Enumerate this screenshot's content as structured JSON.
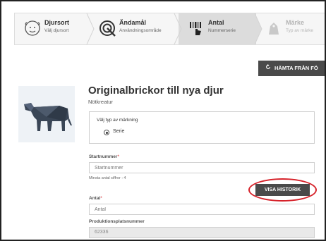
{
  "stepper": {
    "steps": [
      {
        "title": "Djursort",
        "subtitle": "Välj djursort"
      },
      {
        "title": "Ändamål",
        "subtitle": "Användningsområde"
      },
      {
        "title": "Antal",
        "subtitle": "Nummerserie"
      },
      {
        "title": "Märke",
        "subtitle": "Typ av märke"
      }
    ],
    "active_index": 2
  },
  "toolbar": {
    "import_label": "HÄMTA FRÅN FÖ"
  },
  "header": {
    "title": "Originalbrickor till nya djur",
    "subtitle": "Nötkreatur"
  },
  "marking": {
    "label": "Välj typ av märkning",
    "option_label": "Serie"
  },
  "form": {
    "start": {
      "label": "Startnummer",
      "required_mark": "*",
      "placeholder": "Startnummer",
      "hint": "Minsta antal siffror : 4"
    },
    "history_label": "VISA HISTORIK",
    "count": {
      "label": "Antal",
      "required_mark": "*",
      "placeholder": "Antal"
    },
    "prod": {
      "label": "Produktionsplatsnummer",
      "value": "62336"
    }
  },
  "colors": {
    "highlight_ellipse": "#d6222a",
    "button_bg": "#4a4a4a",
    "required": "#d9262a"
  },
  "icons": [
    "sheep-icon",
    "target-icon",
    "barcode-hand-icon",
    "tag-icon",
    "refresh-icon",
    "cow-icon"
  ]
}
